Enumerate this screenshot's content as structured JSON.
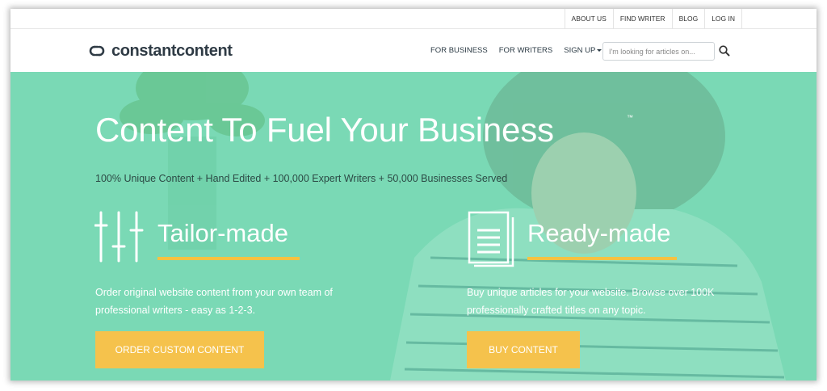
{
  "topbar": {
    "links": [
      "ABOUT US",
      "FIND WRITER",
      "BLOG",
      "LOG IN"
    ]
  },
  "header": {
    "logo_text": "constantcontent",
    "nav": {
      "for_business": "FOR BUSINESS",
      "for_writers": "FOR WRITERS",
      "sign_up": "SIGN UP"
    },
    "search_placeholder": "I'm looking for articles on..."
  },
  "hero": {
    "title": "Content To Fuel Your Business",
    "trademark": "™",
    "subtitle": "100% Unique Content + Hand Edited + 100,000 Expert Writers + 50,000 Businesses Served",
    "tailor": {
      "title": "Tailor-made",
      "description": "Order original website content from your own team of professional writers - easy as 1-2-3.",
      "button": "ORDER CUSTOM CONTENT"
    },
    "ready": {
      "title": "Ready-made",
      "description": "Buy unique articles for your website. Browse over 100K professionally crafted titles on any topic.",
      "button": "BUY CONTENT"
    }
  },
  "colors": {
    "hero_bg": "#7ad9b5",
    "accent_yellow": "#f5c242",
    "logo_text": "#2f3b45"
  },
  "icons": [
    "logo-icon",
    "search-icon",
    "sliders-icon",
    "document-icon"
  ]
}
